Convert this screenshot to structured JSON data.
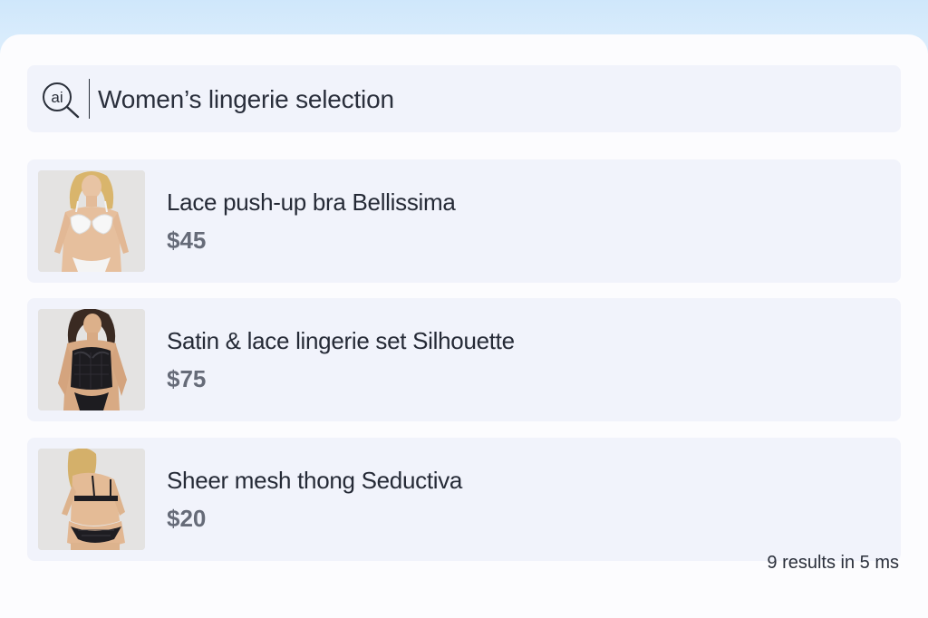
{
  "search": {
    "logo_text": "ai",
    "query": "Women’s lingerie selection"
  },
  "results": [
    {
      "title": "Lace push-up bra Bellissima",
      "price": "$45",
      "image": "model-white-lace-bra-photo"
    },
    {
      "title": "Satin & lace lingerie set Silhouette",
      "price": "$75",
      "image": "model-black-lace-set-photo"
    },
    {
      "title": "Sheer mesh thong Seductiva",
      "price": "$20",
      "image": "model-black-mesh-thong-photo"
    }
  ],
  "footer": {
    "stats": "9 results in 5 ms"
  },
  "colors": {
    "accent_text": "#252a36",
    "price_text": "#666b78",
    "card_background": "#f1f3fb",
    "page_gradient_top": "#cfe7fb"
  }
}
